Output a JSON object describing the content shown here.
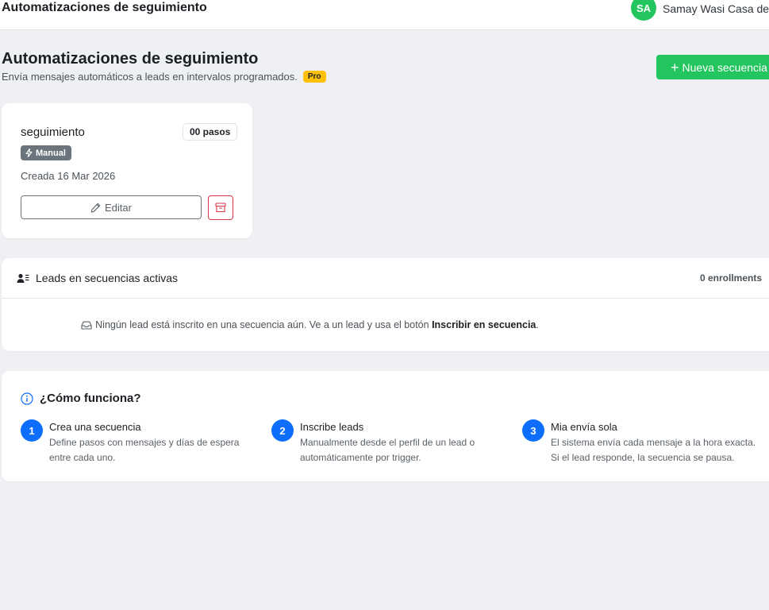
{
  "topbar": {
    "title": "Automatizaciones de seguimiento",
    "avatar_initials": "SA",
    "user_name": "Samay Wasi Casa de p"
  },
  "header": {
    "title": "Automatizaciones de seguimiento",
    "subtitle": "Envía mensajes automáticos a leads en intervalos programados.",
    "pro_badge": "Pro",
    "new_sequence_label": "Nueva secuencia"
  },
  "sequences": [
    {
      "name": "seguimiento",
      "steps_label": "00 pasos",
      "trigger_label": "Manual",
      "created_label": "Creada 16 Mar 2026",
      "edit_label": "Editar"
    }
  ],
  "leads": {
    "title": "Leads en secuencias activas",
    "enrollments": "0 enrollments",
    "empty_text": "Ningún lead está inscrito en una secuencia aún. Ve a un lead y usa el botón",
    "empty_bold": "Inscribir en secuencia",
    "empty_end": "."
  },
  "how": {
    "title": "¿Cómo funciona?",
    "steps": [
      {
        "num": "1",
        "title": "Crea una secuencia",
        "desc": "Define pasos con mensajes y días de espera entre cada uno."
      },
      {
        "num": "2",
        "title": "Inscribe leads",
        "desc": "Manualmente desde el perfil de un lead o automáticamente por trigger."
      },
      {
        "num": "3",
        "title": "Mia envía sola",
        "desc": "El sistema envía cada mensaje a la hora exacta. Si el lead responde, la secuencia se pausa."
      }
    ]
  },
  "colors": {
    "primary_green": "#22c55e",
    "pro_yellow": "#ffc107",
    "step_blue": "#0d6efd",
    "danger_red": "#dc3545"
  }
}
